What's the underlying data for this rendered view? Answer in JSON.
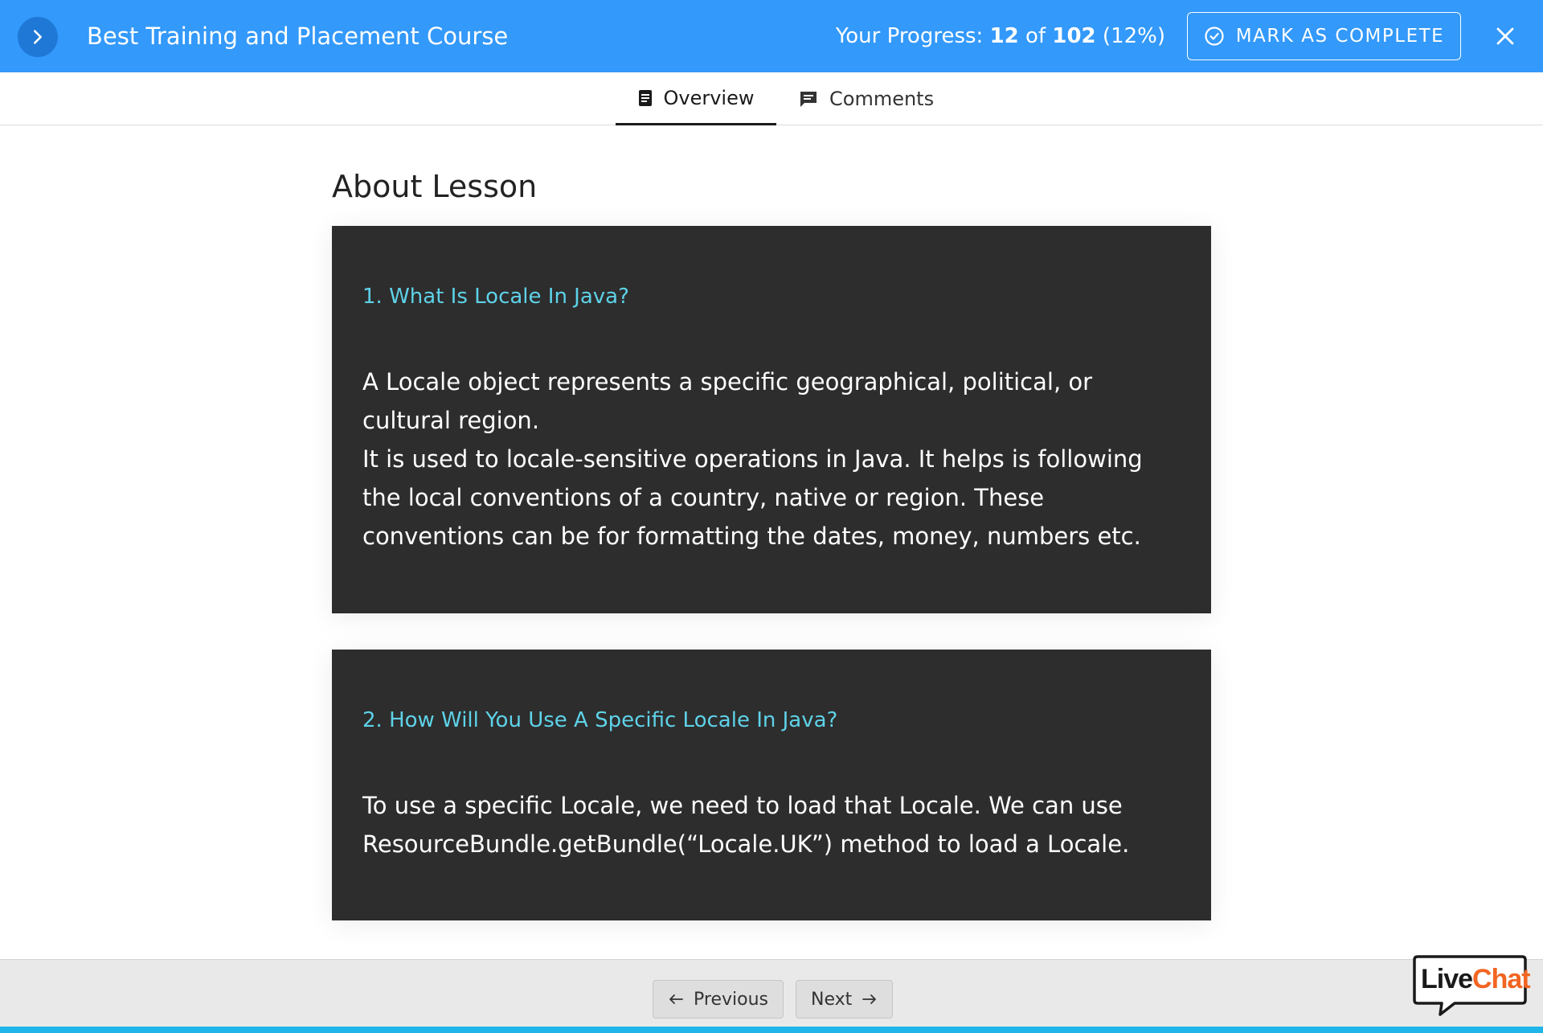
{
  "header": {
    "course_title": "Best Training and Placement Course",
    "progress_label": "Your Progress:",
    "progress_current": "12",
    "progress_of": "of",
    "progress_total": "102",
    "progress_percent": "(12%)",
    "mark_complete_label": "MARK AS COMPLETE"
  },
  "tabs": [
    {
      "label": "Overview",
      "active": true
    },
    {
      "label": "Comments",
      "active": false
    }
  ],
  "lesson": {
    "heading": "About Lesson",
    "items": [
      {
        "question": "1. What Is Locale In Java?",
        "answer_lines": [
          "A Locale object represents a specific geographical, political, or cultural region.",
          "It is used to locale-sensitive operations in Java. It helps is following the local conventions of a country, native or region. These conventions can be for formatting the dates, money, numbers etc."
        ]
      },
      {
        "question": "2. How Will You Use A Specific Locale In Java?",
        "answer_lines": [
          "To use a specific Locale, we need to load that Locale. We can use ResourceBundle.getBundle(“Locale.UK”) method to load a Locale."
        ]
      }
    ]
  },
  "footer": {
    "previous_label": "Previous",
    "next_label": "Next"
  },
  "livechat": {
    "live": "Live",
    "chat": "Chat"
  },
  "colors": {
    "header_bg": "#3399fa",
    "card_bg": "#2d2d2d",
    "question_color": "#5ed2e8",
    "accent_strip": "#1fb5e8",
    "livechat_orange": "#f26522"
  },
  "icons": {
    "sidebar_toggle": "chevron-right-icon",
    "mark_complete": "check-circle-icon",
    "close": "close-icon",
    "overview_tab": "document-icon",
    "comments_tab": "comment-icon",
    "previous": "arrow-left-icon",
    "next": "arrow-right-icon"
  }
}
